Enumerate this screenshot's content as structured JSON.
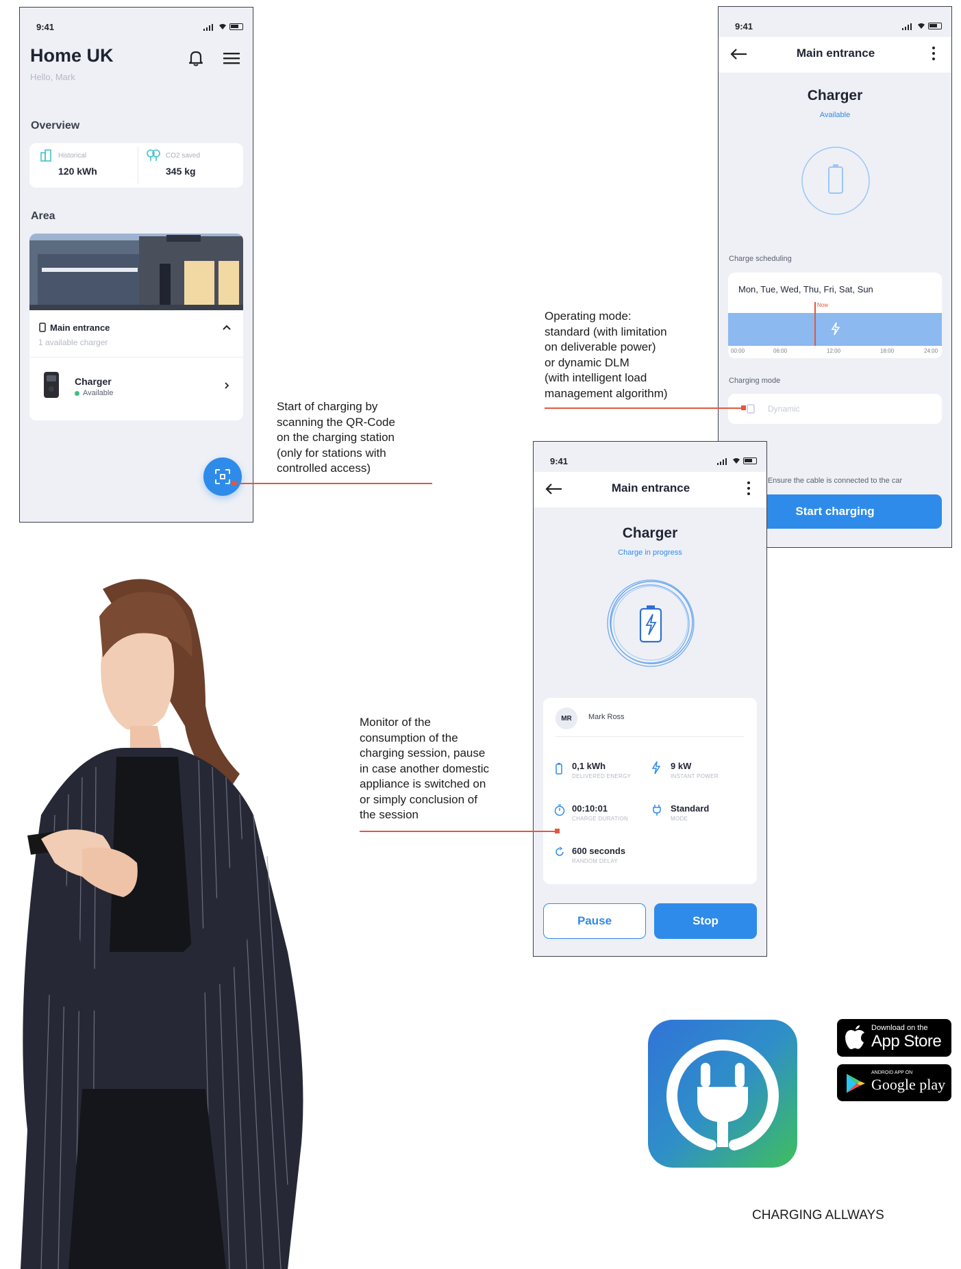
{
  "status_time": "9:41",
  "home": {
    "title": "Home UK",
    "greeting": "Hello, Mark",
    "overview_label": "Overview",
    "historical_label": "Historical",
    "historical_value": "120 kWh",
    "co2_label": "CO2 saved",
    "co2_value": "345 kg",
    "area_label": "Area",
    "location_name": "Main entrance",
    "location_sub": "1 available charger",
    "charger_name": "Charger",
    "charger_status": "Available"
  },
  "schedule_screen": {
    "nav_title": "Main entrance",
    "charger_title": "Charger",
    "charger_status": "Available",
    "scheduling_label": "Charge scheduling",
    "days": "Mon, Tue, Wed, Thu, Fri, Sat, Sun",
    "now_label": "Now",
    "time_ticks": [
      "00:00",
      "06:00",
      "12:00",
      "18:00",
      "24:00"
    ],
    "mode_label": "Charging mode",
    "mode_value": "Dynamic",
    "cable_notice": "Ensure the cable is connected to the car",
    "start_button": "Start charging"
  },
  "progress_screen": {
    "nav_title": "Main entrance",
    "charger_title": "Charger",
    "charger_status": "Charge in progress",
    "user_initials": "MR",
    "user_name": "Mark Ross",
    "energy_value": "0,1 kWh",
    "energy_label": "DELIVERED ENERGY",
    "power_value": "9 kW",
    "power_label": "INSTANT POWER",
    "duration_value": "00:10:01",
    "duration_label": "CHARGE DURATION",
    "mode_value": "Standard",
    "mode_label": "MODE",
    "delay_value": "600 seconds",
    "delay_label": "RANDOM DELAY",
    "pause_button": "Pause",
    "stop_button": "Stop"
  },
  "annotations": {
    "qr": [
      "Start of charging by",
      "scanning the QR-Code",
      "on the charging station",
      "(only for stations with",
      "controlled access)"
    ],
    "mode": [
      "Operating mode:",
      "standard (with limitation",
      "on deliverable power)",
      "or dynamic DLM",
      "(with intelligent load",
      "management algorithm)"
    ],
    "monitor": [
      "Monitor of the",
      "consumption of the",
      "charging session, pause",
      "in case another domestic",
      "appliance is switched on",
      "or simply conclusion of",
      "the session"
    ]
  },
  "app_store": {
    "top": "Download on the",
    "main": "App Store"
  },
  "google_play": {
    "top": "ANDROID APP ON",
    "main": "Google play"
  },
  "tagline": "CHARGING ALLWAYS",
  "colors": {
    "accent": "#2e8bea",
    "annotation": "#e2583d",
    "available": "#3fbf7f"
  }
}
